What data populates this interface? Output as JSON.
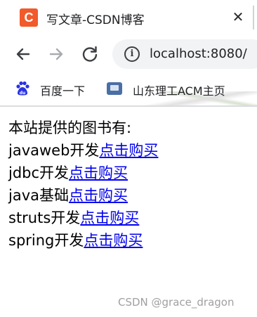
{
  "browser": {
    "tab": {
      "favicon_letter": "C",
      "favicon_color": "#f15a2a",
      "title": "写文章-CSDN博客",
      "close_glyph": "✕"
    },
    "toolbar": {
      "back_icon": "arrow-left-icon",
      "forward_icon": "arrow-right-icon",
      "reload_icon": "reload-icon",
      "info_glyph": "i",
      "url": "localhost:8080/"
    },
    "bookmarks": [
      {
        "label": "百度一下",
        "icon": "baidu-paw-icon"
      },
      {
        "label": "山东理工ACM主页",
        "icon": "acm-page-icon"
      }
    ]
  },
  "page": {
    "intro": "本站提供的图书有:",
    "books": [
      {
        "name": "javaweb开发",
        "link": "点击购买"
      },
      {
        "name": "jdbc开发",
        "link": "点击购买"
      },
      {
        "name": "java基础",
        "link": "点击购买"
      },
      {
        "name": "struts开发",
        "link": "点击购买"
      },
      {
        "name": "spring开发",
        "link": "点击购买"
      }
    ],
    "link_color": "#0000ee"
  },
  "watermark": "CSDN @grace_dragon"
}
